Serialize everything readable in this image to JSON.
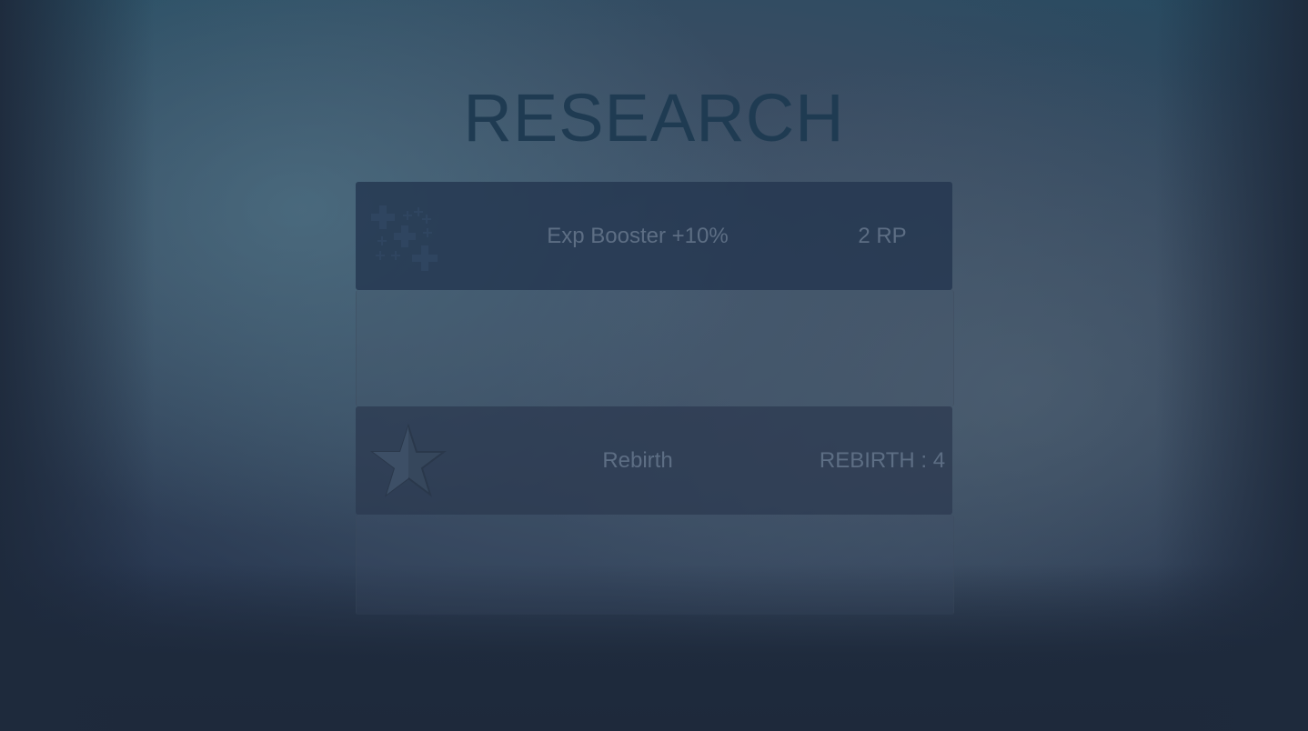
{
  "screen": {
    "title": "RESEARCH"
  },
  "research_items": [
    {
      "icon": "plus-cluster-icon",
      "label": "Exp Booster +10%",
      "cost": "2 RP"
    },
    {
      "icon": "star-icon",
      "label": "Rebirth",
      "cost": "REBIRTH : 4"
    }
  ],
  "colors": {
    "title": "#1f3b52",
    "text": "#5d6e84",
    "panel": "#22344e",
    "background": "#1e2a3c"
  }
}
